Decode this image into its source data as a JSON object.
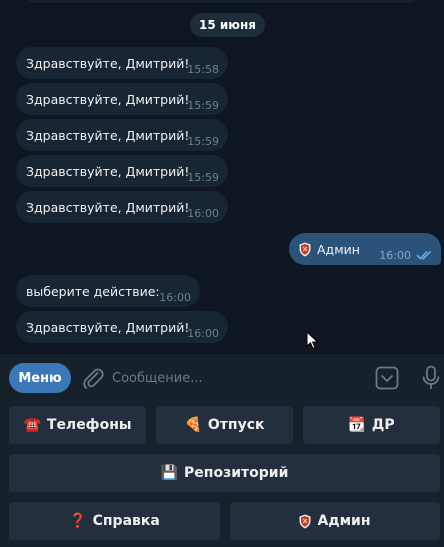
{
  "chat": {
    "date": "15 июня",
    "messages": [
      {
        "text": "Здравствуйте, Дмитрий!",
        "time": "15:58"
      },
      {
        "text": "Здравствуйте, Дмитрий!",
        "time": "15:59"
      },
      {
        "text": "Здравствуйте, Дмитрий!",
        "time": "15:59"
      },
      {
        "text": "Здравствуйте, Дмитрий!",
        "time": "15:59"
      },
      {
        "text": "Здравствуйте, Дмитрий!",
        "time": "16:00"
      },
      {
        "text": "Админ",
        "time": "16:00"
      },
      {
        "text": "выберите действие:",
        "time": "16:00"
      },
      {
        "text": "Здравствуйте, Дмитрий!",
        "time": "16:00"
      }
    ]
  },
  "composer": {
    "menu_label": "Меню",
    "placeholder": "Сообщение..."
  },
  "keyboard": {
    "phones": {
      "icon": "☎️",
      "label": "Телефоны"
    },
    "vacation": {
      "icon": "🍕",
      "label": "Отпуск"
    },
    "birthday": {
      "icon": "📆",
      "label": "ДР"
    },
    "repository": {
      "icon": "💾",
      "label": "Репозиторий"
    },
    "help": {
      "icon": "❓",
      "label": "Справка"
    },
    "admin": {
      "label": "Админ"
    }
  },
  "colors": {
    "background": "#0e1621",
    "incoming_bubble": "#182533",
    "outgoing_bubble": "#2b5278",
    "accent": "#3a78b7",
    "panel": "#17212b",
    "key_button": "#232f3c"
  },
  "icons": [
    "shield-icon",
    "double-check-icon",
    "paperclip-icon",
    "keyboard-icon",
    "microphone-icon",
    "mouse-cursor-icon"
  ]
}
